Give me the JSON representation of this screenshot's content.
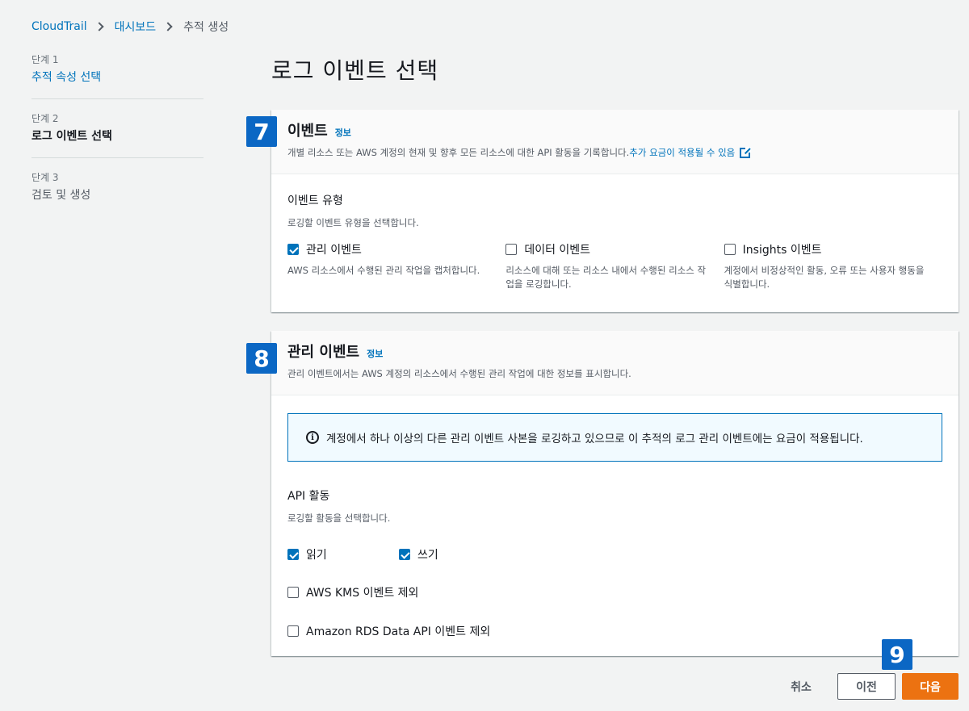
{
  "breadcrumb": [
    "CloudTrail",
    "대시보드",
    "추적 생성"
  ],
  "steps": [
    {
      "num": "단계 1",
      "title": "추적 속성 선택"
    },
    {
      "num": "단계 2",
      "title": "로그 이벤트 선택"
    },
    {
      "num": "단계 3",
      "title": "검토 및 생성"
    }
  ],
  "page_title": "로그 이벤트 선택",
  "markers": {
    "m7": "7",
    "m8": "8",
    "m9": "9"
  },
  "events": {
    "title": "이벤트",
    "info": "정보",
    "desc": "개별 리소스 또는 AWS 계정의 현재 및 향후 모든 리소스에 대한 API 활동을 기록합니다.",
    "desc_link": "추가 요금이 적용될 수 있음",
    "type_label": "이벤트 유형",
    "type_sublabel": "로깅할 이벤트 유형을 선택합니다.",
    "options": [
      {
        "label": "관리 이벤트",
        "desc": "AWS 리소스에서 수행된 관리 작업을 캡처합니다.",
        "checked": true
      },
      {
        "label": "데이터 이벤트",
        "desc": "리소스에 대해 또는 리소스 내에서 수행된 리소스 작업을 로깅합니다.",
        "checked": false
      },
      {
        "label": "Insights 이벤트",
        "desc": "계정에서 비정상적인 활동, 오류 또는 사용자 행동을 식별합니다.",
        "checked": false
      }
    ]
  },
  "management": {
    "title": "관리 이벤트",
    "info": "정보",
    "desc": "관리 이벤트에서는 AWS 계정의 리소스에서 수행된 관리 작업에 대한 정보를 표시합니다.",
    "alert": "계정에서 하나 이상의 다른 관리 이벤트 사본을 로깅하고 있으므로 이 추적의 로그 관리 이벤트에는 요금이 적용됩니다.",
    "api_label": "API 활동",
    "api_sublabel": "로깅할 활동을 선택합니다.",
    "read": "읽기",
    "write": "쓰기",
    "exclude_kms": "AWS KMS 이벤트 제외",
    "exclude_rds": "Amazon RDS Data API 이벤트 제외"
  },
  "footer": {
    "cancel": "취소",
    "previous": "이전",
    "next": "다음"
  },
  "colors": {
    "accent": "#0073bb",
    "primary_button": "#ec7211",
    "marker": "#0b67c4"
  }
}
